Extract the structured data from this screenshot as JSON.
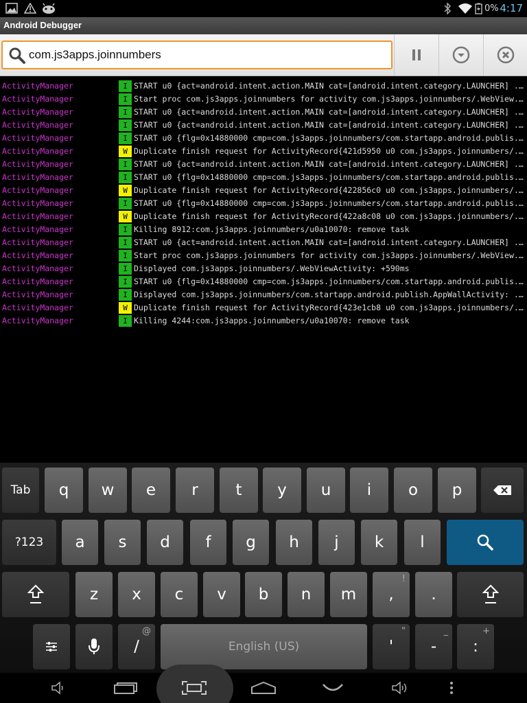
{
  "status_bar": {
    "icons_left": [
      "image-icon",
      "warning-icon",
      "android-icon"
    ],
    "icons_right": [
      "bluetooth-icon",
      "wifi-icon",
      "battery-icon"
    ],
    "battery": "0%",
    "time": "4:17",
    "time_color": "#6ec3e9"
  },
  "app": {
    "title": "Android Debugger"
  },
  "toolbar": {
    "search_value": "com.js3apps.joinnumbers",
    "accent": "#f0962b"
  },
  "log": {
    "level_colors": {
      "I": "#1fb31f",
      "W": "#f2f200"
    },
    "tag_color": "#cc33cc",
    "entries": [
      {
        "tag": "ActivityManager",
        "level": "I",
        "msg": "START u0 {act=android.intent.action.MAIN cat=[android.intent.category.LAUNCHER] ..."
      },
      {
        "tag": "ActivityManager",
        "level": "I",
        "msg": "Start proc com.js3apps.joinnumbers for activity com.js3apps.joinnumbers/.WebView..."
      },
      {
        "tag": "ActivityManager",
        "level": "I",
        "msg": "START u0 {act=android.intent.action.MAIN cat=[android.intent.category.LAUNCHER] ..."
      },
      {
        "tag": "ActivityManager",
        "level": "I",
        "msg": "START u0 {act=android.intent.action.MAIN cat=[android.intent.category.LAUNCHER] ..."
      },
      {
        "tag": "ActivityManager",
        "level": "I",
        "msg": "START u0 {flg=0x14880000 cmp=com.js3apps.joinnumbers/com.startapp.android.publis..."
      },
      {
        "tag": "ActivityManager",
        "level": "W",
        "msg": "Duplicate finish request for ActivityRecord{421d5950 u0 com.js3apps.joinnumbers/..."
      },
      {
        "tag": "ActivityManager",
        "level": "I",
        "msg": "START u0 {act=android.intent.action.MAIN cat=[android.intent.category.LAUNCHER] ..."
      },
      {
        "tag": "ActivityManager",
        "level": "I",
        "msg": "START u0 {flg=0x14880000 cmp=com.js3apps.joinnumbers/com.startapp.android.publis..."
      },
      {
        "tag": "ActivityManager",
        "level": "W",
        "msg": "Duplicate finish request for ActivityRecord{422856c0 u0 com.js3apps.joinnumbers/..."
      },
      {
        "tag": "ActivityManager",
        "level": "I",
        "msg": "START u0 {flg=0x14880000 cmp=com.js3apps.joinnumbers/com.startapp.android.publis..."
      },
      {
        "tag": "ActivityManager",
        "level": "W",
        "msg": "Duplicate finish request for ActivityRecord{422a8c08 u0 com.js3apps.joinnumbers/..."
      },
      {
        "tag": "ActivityManager",
        "level": "I",
        "msg": "Killing 8912:com.js3apps.joinnumbers/u0a10070: remove task"
      },
      {
        "tag": "ActivityManager",
        "level": "I",
        "msg": "START u0 {act=android.intent.action.MAIN cat=[android.intent.category.LAUNCHER] ..."
      },
      {
        "tag": "ActivityManager",
        "level": "I",
        "msg": "Start proc com.js3apps.joinnumbers for activity com.js3apps.joinnumbers/.WebView..."
      },
      {
        "tag": "ActivityManager",
        "level": "I",
        "msg": "Displayed com.js3apps.joinnumbers/.WebViewActivity: +590ms"
      },
      {
        "tag": "ActivityManager",
        "level": "I",
        "msg": "START u0 {flg=0x14880000 cmp=com.js3apps.joinnumbers/com.startapp.android.publis..."
      },
      {
        "tag": "ActivityManager",
        "level": "I",
        "msg": "Displayed com.js3apps.joinnumbers/com.startapp.android.publish.AppWallActivity: ..."
      },
      {
        "tag": "ActivityManager",
        "level": "W",
        "msg": "Duplicate finish request for ActivityRecord{423e1cb8 u0 com.js3apps.joinnumbers/..."
      },
      {
        "tag": "ActivityManager",
        "level": "I",
        "msg": "Killing 4244:com.js3apps.joinnumbers/u0a10070: remove task"
      }
    ]
  },
  "keyboard": {
    "row1": [
      "Tab",
      "q",
      "w",
      "e",
      "r",
      "t",
      "y",
      "u",
      "i",
      "o",
      "p"
    ],
    "row2": [
      "?123",
      "a",
      "s",
      "d",
      "f",
      "g",
      "h",
      "j",
      "k",
      "l"
    ],
    "row3": [
      "z",
      "x",
      "c",
      "v",
      "b",
      "n",
      "m",
      ",",
      "."
    ],
    "row3_hints": {
      ",": "!",
      ".": "?"
    },
    "row4": {
      "slash": "/",
      "slash_hint": "@",
      "space": "English (US)",
      "apostrophe": "'",
      "apostrophe_hint": "\"",
      "dash": "-",
      "dash_hint": "_",
      "colon": ":",
      "colon_hint": "+"
    },
    "search_key_color": "#0f5a84"
  },
  "nav_bar": {
    "buttons": [
      "volume-down-icon",
      "recent-apps-icon",
      "screenshot-icon",
      "home-icon",
      "back-icon",
      "volume-up-icon",
      "menu-icon"
    ]
  }
}
